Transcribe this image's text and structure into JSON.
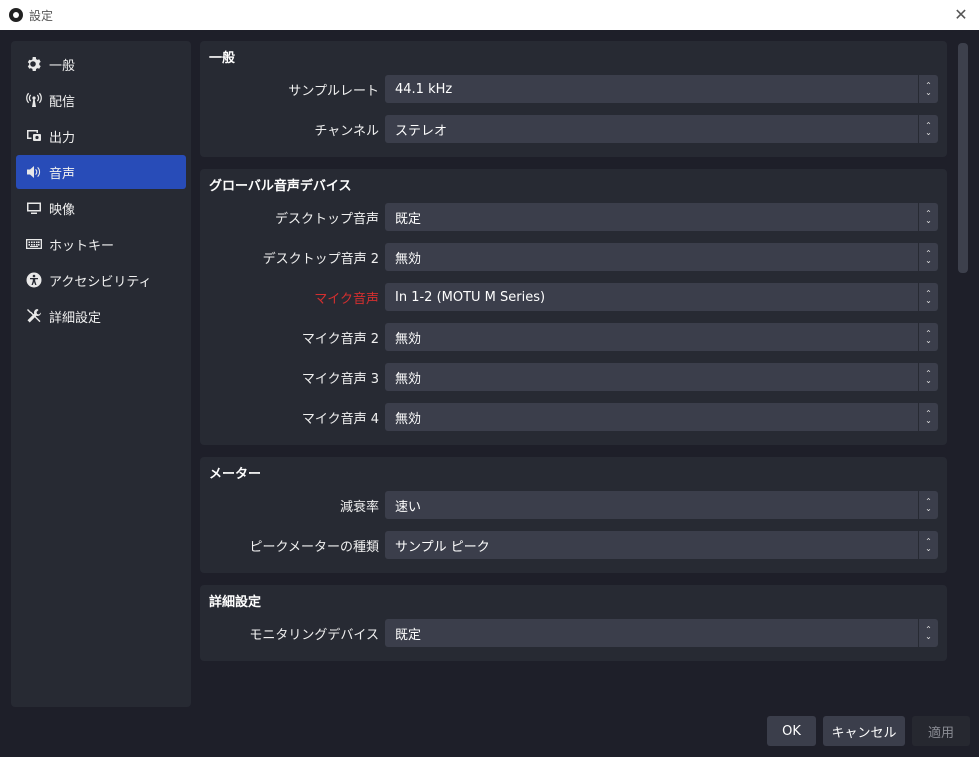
{
  "window": {
    "title": "設定",
    "close_glyph": "✕"
  },
  "sidebar": {
    "items": [
      {
        "label": "一般",
        "icon": "gear-icon"
      },
      {
        "label": "配信",
        "icon": "broadcast-icon"
      },
      {
        "label": "出力",
        "icon": "output-icon"
      },
      {
        "label": "音声",
        "icon": "speaker-icon",
        "active": true
      },
      {
        "label": "映像",
        "icon": "monitor-icon"
      },
      {
        "label": "ホットキー",
        "icon": "keyboard-icon"
      },
      {
        "label": "アクセシビリティ",
        "icon": "accessibility-icon"
      },
      {
        "label": "詳細設定",
        "icon": "tools-icon"
      }
    ]
  },
  "groups": [
    {
      "title": "一般",
      "rows": [
        {
          "label": "サンプルレート",
          "value": "44.1 kHz"
        },
        {
          "label": "チャンネル",
          "value": "ステレオ"
        }
      ]
    },
    {
      "title": "グローバル音声デバイス",
      "rows": [
        {
          "label": "デスクトップ音声",
          "value": "既定"
        },
        {
          "label": "デスクトップ音声 2",
          "value": "無効"
        },
        {
          "label": "マイク音声",
          "value": "In 1-2 (MOTU M Series)",
          "highlight": "#d42f2f"
        },
        {
          "label": "マイク音声 2",
          "value": "無効"
        },
        {
          "label": "マイク音声 3",
          "value": "無効"
        },
        {
          "label": "マイク音声 4",
          "value": "無効"
        }
      ]
    },
    {
      "title": "メーター",
      "rows": [
        {
          "label": "減衰率",
          "value": "速い"
        },
        {
          "label": "ピークメーターの種類",
          "value": "サンプル ピーク"
        }
      ]
    },
    {
      "title": "詳細設定",
      "rows": [
        {
          "label": "モニタリングデバイス",
          "value": "既定"
        }
      ]
    }
  ],
  "buttons": {
    "ok": "OK",
    "cancel": "キャンセル",
    "apply": "適用"
  },
  "colors": {
    "accent": "#284cb8",
    "background": "#1e1f29",
    "panel": "#272a33",
    "field": "#3b3e4b"
  }
}
